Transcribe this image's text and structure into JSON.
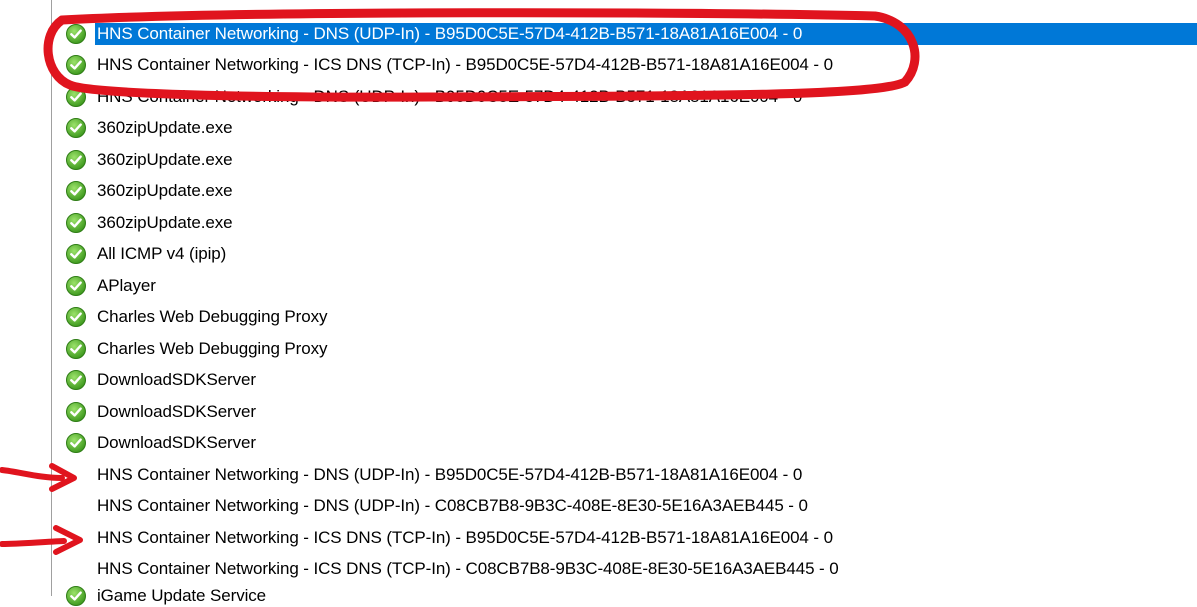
{
  "list": {
    "items": [
      {
        "label": "HNS Container Networking - DNS (UDP-In) - B95D0C5E-57D4-412B-B571-18A81A16E004 - 0",
        "enabled": true,
        "selected": true
      },
      {
        "label": "HNS Container Networking - ICS DNS (TCP-In) - B95D0C5E-57D4-412B-B571-18A81A16E004 - 0",
        "enabled": true
      },
      {
        "label": "HNS Container Networking - DNS (UDP-In) - B95D0C5E-57D4-412B-B571-18A81A16E004 - 0",
        "enabled": true
      },
      {
        "label": "360zipUpdate.exe",
        "enabled": true
      },
      {
        "label": "360zipUpdate.exe",
        "enabled": true
      },
      {
        "label": "360zipUpdate.exe",
        "enabled": true
      },
      {
        "label": "360zipUpdate.exe",
        "enabled": true
      },
      {
        "label": "All ICMP v4 (ipip)",
        "enabled": true
      },
      {
        "label": "APlayer",
        "enabled": true
      },
      {
        "label": "Charles Web Debugging Proxy",
        "enabled": true
      },
      {
        "label": "Charles Web Debugging Proxy",
        "enabled": true
      },
      {
        "label": "DownloadSDKServer",
        "enabled": true
      },
      {
        "label": "DownloadSDKServer",
        "enabled": true
      },
      {
        "label": "DownloadSDKServer",
        "enabled": true
      },
      {
        "label": "HNS Container Networking - DNS (UDP-In) - B95D0C5E-57D4-412B-B571-18A81A16E004 - 0",
        "enabled": false
      },
      {
        "label": "HNS Container Networking - DNS (UDP-In) - C08CB7B8-9B3C-408E-8E30-5E16A3AEB445 - 0",
        "enabled": false
      },
      {
        "label": "HNS Container Networking - ICS DNS (TCP-In) - B95D0C5E-57D4-412B-B571-18A81A16E004 - 0",
        "enabled": false
      },
      {
        "label": "HNS Container Networking - ICS DNS (TCP-In) - C08CB7B8-9B3C-408E-8E30-5E16A3AEB445 - 0",
        "enabled": false
      },
      {
        "label": "iGame Update Service",
        "enabled": true,
        "partial": true
      }
    ],
    "icon": "green-check-circle-icon",
    "colors": {
      "selection": "#0078d7",
      "check_green": "#4caf2a",
      "annotation_red": "#e0141e"
    }
  }
}
